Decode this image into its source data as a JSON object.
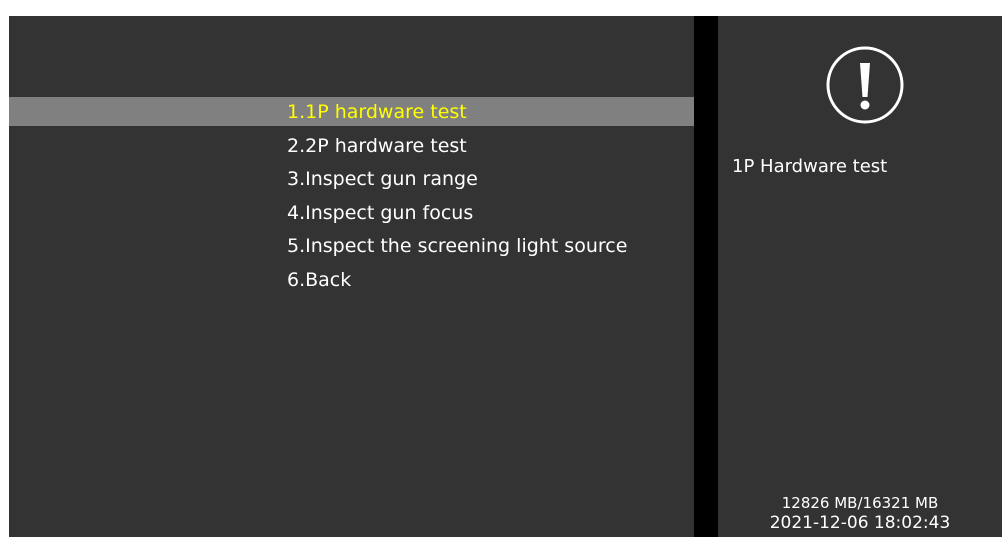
{
  "menu": {
    "items": [
      {
        "label": "1.1P hardware test",
        "selected": true
      },
      {
        "label": "2.2P hardware test",
        "selected": false
      },
      {
        "label": "3.Inspect gun range",
        "selected": false
      },
      {
        "label": "4.Inspect gun focus",
        "selected": false
      },
      {
        "label": "5.Inspect the screening light source",
        "selected": false
      },
      {
        "label": "6.Back",
        "selected": false
      }
    ]
  },
  "info_panel": {
    "icon": "exclamation-circle-icon",
    "description": "1P Hardware test",
    "memory": "12826 MB/16321 MB",
    "datetime": "2021-12-06 18:02:43"
  },
  "colors": {
    "panel_background": "#333333",
    "highlight_bar": "#808080",
    "selected_text": "#ffff00",
    "text": "#ffffff",
    "divider": "#000000"
  }
}
